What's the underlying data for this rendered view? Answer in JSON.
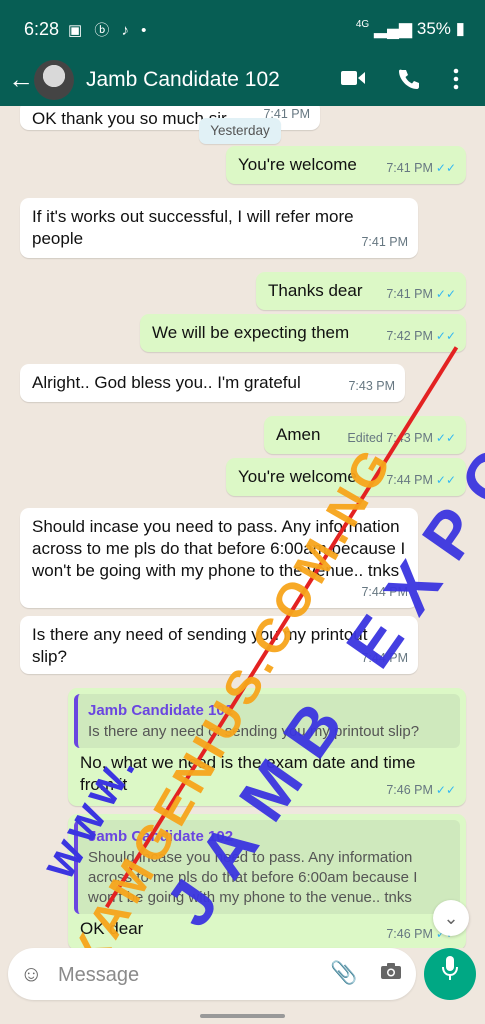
{
  "status_bar": {
    "time": "6:28",
    "battery": "35%",
    "network": "4G"
  },
  "header": {
    "contact_name": "Jamb Candidate 102"
  },
  "date_chip": "Yesterday",
  "messages": [
    {
      "dir": "in",
      "text": "OK thank you so much sir",
      "time": "7:41 PM"
    },
    {
      "dir": "out",
      "text": "You're welcome",
      "time": "7:41 PM",
      "ticks": "✓✓"
    },
    {
      "dir": "in",
      "text": "If it's works out successful,  I will refer more people",
      "time": "7:41 PM"
    },
    {
      "dir": "out",
      "text": "Thanks dear",
      "time": "7:41 PM",
      "ticks": "✓✓"
    },
    {
      "dir": "out",
      "text": "We will be expecting them",
      "time": "7:42 PM",
      "ticks": "✓✓"
    },
    {
      "dir": "in",
      "text": "Alright.. God bless you.. I'm grateful",
      "time": "7:43 PM"
    },
    {
      "dir": "out",
      "text": "Amen",
      "time": "Edited 7:43 PM",
      "ticks": "✓✓"
    },
    {
      "dir": "out",
      "text": "You're welcome",
      "time": "7:44 PM",
      "ticks": "✓✓"
    },
    {
      "dir": "in",
      "text": "Should incase you need to pass. Any information across to me pls do that before 6:00am because I won't be going with my phone to the venue.. tnks",
      "time": "7:44 PM"
    },
    {
      "dir": "in",
      "text": "Is there any need of sending you my printout slip?",
      "time": "7:44 PM"
    },
    {
      "dir": "out",
      "quote_name": "Jamb Candidate 102",
      "quote_text": "Is there any need of sending you my printout slip?",
      "text": "No,  what we need is the exam date and time from it",
      "time": "7:46 PM",
      "ticks": "✓✓"
    },
    {
      "dir": "out",
      "quote_name": "Jamb Candidate 102",
      "quote_text": "Should incase you need to pass. Any information across to me pls do that before 6:00am because I won't be going with my phone to the venue.. tnks",
      "text": "OK dear",
      "time": "7:46 PM",
      "ticks": "✓✓"
    }
  ],
  "watermarks": {
    "site": "EXAMGENIUS.COM.NG",
    "www": "WWW.",
    "brand": "JAMB EXPO"
  },
  "composer": {
    "placeholder": "Message"
  },
  "colors": {
    "header": "#075e54",
    "outgoing": "#dcf8c6",
    "incoming": "#ffffff",
    "tick": "#34b7f1",
    "mic": "#00a884"
  },
  "icons": [
    "back-arrow-icon",
    "video-call-icon",
    "phone-icon",
    "more-options-icon",
    "emoji-icon",
    "attach-icon",
    "camera-icon",
    "mic-icon",
    "scroll-down-icon"
  ]
}
